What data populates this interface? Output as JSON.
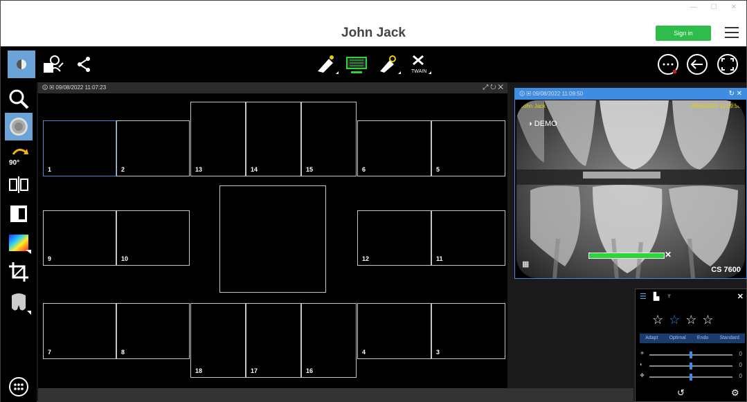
{
  "window": {
    "title": "John Jack",
    "sign_in_label": "Sign in",
    "min_glyph": "—",
    "max_glyph": "☐",
    "close_glyph": "✕"
  },
  "toolbar": {
    "left_icons": [
      "brightness-icon",
      "patient-user-icon",
      "share-icon"
    ],
    "center_icons": [
      "acquire-xray-icon",
      "sensor-acquire-icon",
      "acquire-ceph-icon",
      "twain-icon"
    ],
    "twain_label": "TWAIN",
    "right_icons": [
      "more-options-icon",
      "back-arrow-icon",
      "fullscreen-icon"
    ]
  },
  "sidebar": {
    "icons": [
      "zoom-icon",
      "filter-icon",
      "rotate-90-icon",
      "mirror-icon",
      "invert-icon",
      "colorize-icon",
      "crop-icon",
      "tooth-icon"
    ],
    "rotate_label": "90°",
    "apps_icon": "apps-grid-icon"
  },
  "viewer": {
    "header_date": "09/08/2022 11:07:23",
    "slots": [
      "1",
      "2",
      "13",
      "14",
      "15",
      "6",
      "5",
      "9",
      "10",
      "12",
      "11",
      "7",
      "8",
      "18",
      "17",
      "16",
      "4",
      "3"
    ]
  },
  "preview": {
    "header_date": "09/08/2022 11:09:50",
    "patient_label": "John Jack",
    "date_label": "09/08/2022 11:09:50",
    "demo_label": "DEMO",
    "device_label": "CS 7600",
    "progress": 1.0
  },
  "adjust_panel": {
    "stars_count": 4,
    "selected_star": 2,
    "modes": [
      "Adapt",
      "Optimal",
      "Endo",
      "Standard"
    ],
    "sliders": [
      {
        "icon": "☀",
        "value": "0",
        "level": 0.5
      },
      {
        "icon": "◐",
        "value": "0",
        "level": 0.5
      },
      {
        "icon": "❖",
        "value": "0",
        "level": 0.5
      }
    ]
  },
  "colors": {
    "accent": "#3e8de0",
    "active_tool": "#6aa3d8",
    "signin": "#2ebd4a",
    "progress": "#2cd63a",
    "overlay_text": "#e8d300"
  }
}
